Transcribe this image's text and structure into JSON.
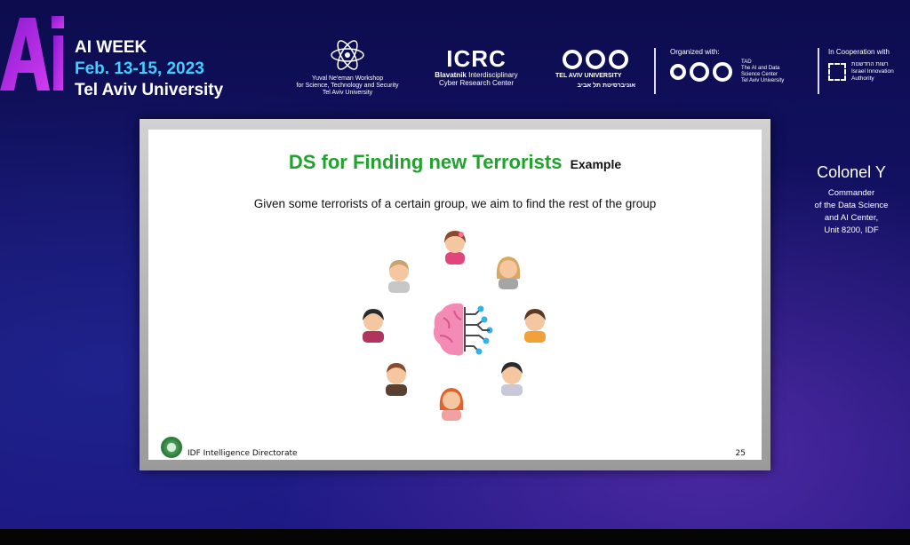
{
  "event": {
    "logo_text": "Ai",
    "title_line1": "AI WEEK",
    "title_line2": "Feb. 13-15, 2023",
    "title_line3": "Tel Aviv University"
  },
  "sponsors": {
    "yuval": {
      "line1": "Yuval Ne'eman Workshop",
      "line2": "for Science, Technology and Security",
      "line3": "Tel Aviv University"
    },
    "icrc": {
      "acronym": "ICRC",
      "line1_bold": "Blavatnik",
      "line1_rest": " Interdisciplinary",
      "line2": "Cyber Research Center"
    },
    "tau": {
      "en": "TEL AVIV UNIVERSITY",
      "he": "אוניברסיטת תל אביב"
    },
    "organized": {
      "label": "Organized with:",
      "tad_line1": "TAD",
      "tad_line2": "The AI and Data",
      "tad_line3": "Science Center",
      "tad_line4": "Tel Aviv University"
    },
    "cooperation": {
      "label": "In Cooperation with",
      "he": "רשות החדשנות",
      "line1": "Israel Innovation",
      "line2": "Authority"
    }
  },
  "slide": {
    "title": "DS for Finding new Terrorists",
    "title_suffix": "Example",
    "description": "Given some terrorists of a certain group, we aim to find the rest of the group",
    "footer": "IDF Intelligence Directorate",
    "page": "25"
  },
  "speaker": {
    "name": "Colonel Y",
    "role_line1": "Commander",
    "role_line2": "of the Data Science",
    "role_line3": "and AI Center,",
    "role_line4": "Unit 8200, IDF"
  },
  "colors": {
    "title_green": "#1fa32b",
    "accent_cyan": "#3fd0ff",
    "logo_magenta": "#b41be0",
    "background": "#141266"
  }
}
